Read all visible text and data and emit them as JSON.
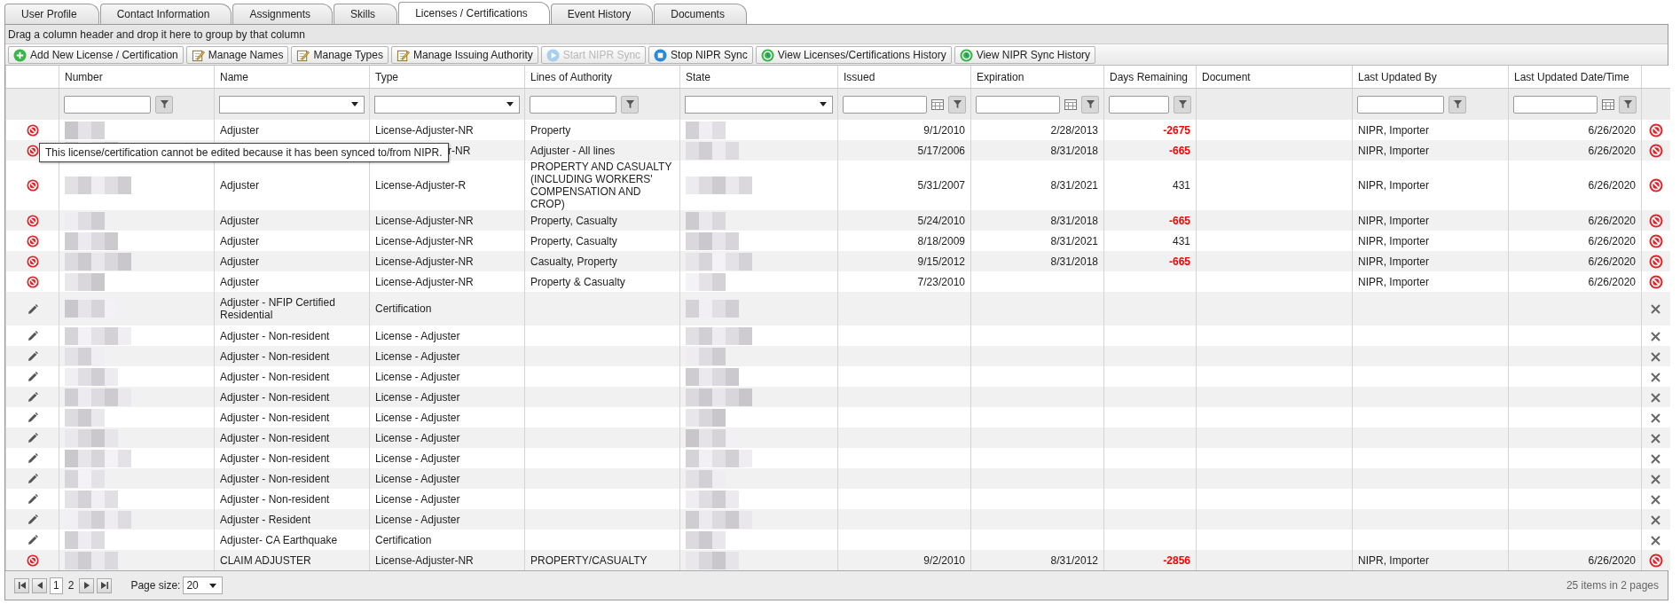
{
  "tabs": [
    {
      "label": "User Profile",
      "selected": false
    },
    {
      "label": "Contact Information",
      "selected": false
    },
    {
      "label": "Assignments",
      "selected": false
    },
    {
      "label": "Skills",
      "selected": false
    },
    {
      "label": "Licenses / Certifications",
      "selected": true
    },
    {
      "label": "Event History",
      "selected": false
    },
    {
      "label": "Documents",
      "selected": false
    }
  ],
  "group_panel": {
    "hint": "Drag a column header and drop it here to group by that column"
  },
  "toolbar": [
    {
      "label": "Add New License / Certification",
      "kind": "add",
      "disabled": false
    },
    {
      "label": "Manage Names",
      "kind": "edit",
      "disabled": false
    },
    {
      "label": "Manage Types",
      "kind": "edit",
      "disabled": false
    },
    {
      "label": "Manage Issuing Authority",
      "kind": "edit",
      "disabled": false
    },
    {
      "label": "Start NIPR Sync",
      "kind": "play",
      "disabled": true
    },
    {
      "label": "Stop NIPR Sync",
      "kind": "stop",
      "disabled": false
    },
    {
      "label": "View Licenses/Certifications History",
      "kind": "history",
      "disabled": false
    },
    {
      "label": "View NIPR Sync History",
      "kind": "history",
      "disabled": false
    }
  ],
  "columns": [
    {
      "label": "Number",
      "kind": "text"
    },
    {
      "label": "Name",
      "kind": "select"
    },
    {
      "label": "Type",
      "kind": "select"
    },
    {
      "label": "Lines of Authority",
      "kind": "text"
    },
    {
      "label": "State",
      "kind": "select"
    },
    {
      "label": "Issued",
      "kind": "date"
    },
    {
      "label": "Expiration",
      "kind": "date"
    },
    {
      "label": "Days Remaining",
      "kind": "text"
    },
    {
      "label": "Document",
      "kind": "none"
    },
    {
      "label": "Last Updated By",
      "kind": "text"
    },
    {
      "label": "Last Updated Date/Time",
      "kind": "date"
    }
  ],
  "rows": [
    {
      "kind": "synced",
      "name": "Adjuster",
      "type": "License-Adjuster-NR",
      "lines": "Property",
      "issued": "9/1/2010",
      "expiration": "2/28/2013",
      "days": "-2675",
      "overdue": true,
      "updated_by": "NIPR, Importer",
      "updated_at": "6/26/2020"
    },
    {
      "kind": "synced",
      "tooltip": "This license/certification cannot be edited because it has been synced to/from NIPR.",
      "type": "r-NR",
      "lines": "Adjuster - All lines",
      "issued": "5/17/2006",
      "expiration": "8/31/2018",
      "days": "-665",
      "overdue": true,
      "updated_by": "NIPR, Importer",
      "updated_at": "6/26/2020"
    },
    {
      "kind": "synced",
      "name": "Adjuster",
      "type": "License-Adjuster-R",
      "lines": "PROPERTY AND CASUALTY (INCLUDING WORKERS' COMPENSATION AND CROP)",
      "issued": "5/31/2007",
      "expiration": "8/31/2021",
      "days": "431",
      "overdue": false,
      "updated_by": "NIPR, Importer",
      "updated_at": "6/26/2020"
    },
    {
      "kind": "synced",
      "name": "Adjuster",
      "type": "License-Adjuster-NR",
      "lines": "Property, Casualty",
      "issued": "5/24/2010",
      "expiration": "8/31/2018",
      "days": "-665",
      "overdue": true,
      "updated_by": "NIPR, Importer",
      "updated_at": "6/26/2020"
    },
    {
      "kind": "synced",
      "name": "Adjuster",
      "type": "License-Adjuster-NR",
      "lines": "Property, Casualty",
      "issued": "8/18/2009",
      "expiration": "8/31/2021",
      "days": "431",
      "overdue": false,
      "updated_by": "NIPR, Importer",
      "updated_at": "6/26/2020"
    },
    {
      "kind": "synced",
      "name": "Adjuster",
      "type": "License-Adjuster-NR",
      "lines": "Casualty, Property",
      "issued": "9/15/2012",
      "expiration": "8/31/2018",
      "days": "-665",
      "overdue": true,
      "updated_by": "NIPR, Importer",
      "updated_at": "6/26/2020"
    },
    {
      "kind": "synced",
      "name": "Adjuster",
      "type": "License-Adjuster-NR",
      "lines": "Property & Casualty",
      "issued": "7/23/2010",
      "updated_by": "NIPR, Importer",
      "updated_at": "6/26/2020"
    },
    {
      "kind": "editable",
      "name": "Adjuster - NFIP Certified Residential",
      "type": "Certification"
    },
    {
      "kind": "editable",
      "name": "Adjuster - Non-resident",
      "type": "License - Adjuster"
    },
    {
      "kind": "editable",
      "name": "Adjuster - Non-resident",
      "type": "License - Adjuster"
    },
    {
      "kind": "editable",
      "name": "Adjuster - Non-resident",
      "type": "License - Adjuster"
    },
    {
      "kind": "editable",
      "name": "Adjuster - Non-resident",
      "type": "License - Adjuster"
    },
    {
      "kind": "editable",
      "name": "Adjuster - Non-resident",
      "type": "License - Adjuster"
    },
    {
      "kind": "editable",
      "name": "Adjuster - Non-resident",
      "type": "License - Adjuster"
    },
    {
      "kind": "editable",
      "name": "Adjuster - Non-resident",
      "type": "License - Adjuster"
    },
    {
      "kind": "editable",
      "name": "Adjuster - Non-resident",
      "type": "License - Adjuster"
    },
    {
      "kind": "editable",
      "name": "Adjuster - Non-resident",
      "type": "License - Adjuster"
    },
    {
      "kind": "editable",
      "name": "Adjuster - Resident",
      "type": "License - Adjuster"
    },
    {
      "kind": "editable",
      "name": "Adjuster- CA Earthquake",
      "type": "Certification"
    },
    {
      "kind": "synced",
      "name": "CLAIM ADJUSTER",
      "type": "License-Adjuster-NR",
      "lines": "PROPERTY/CASUALTY",
      "issued": "9/2/2010",
      "expiration": "8/31/2012",
      "days": "-2856",
      "overdue": true,
      "updated_by": "NIPR, Importer",
      "updated_at": "6/26/2020"
    }
  ],
  "pager": {
    "pages": [
      {
        "label": "1",
        "selected": true
      },
      {
        "label": "2",
        "selected": false
      }
    ],
    "page_size_label": "Page size:",
    "page_size": "20",
    "summary": "25 items in 2 pages"
  }
}
